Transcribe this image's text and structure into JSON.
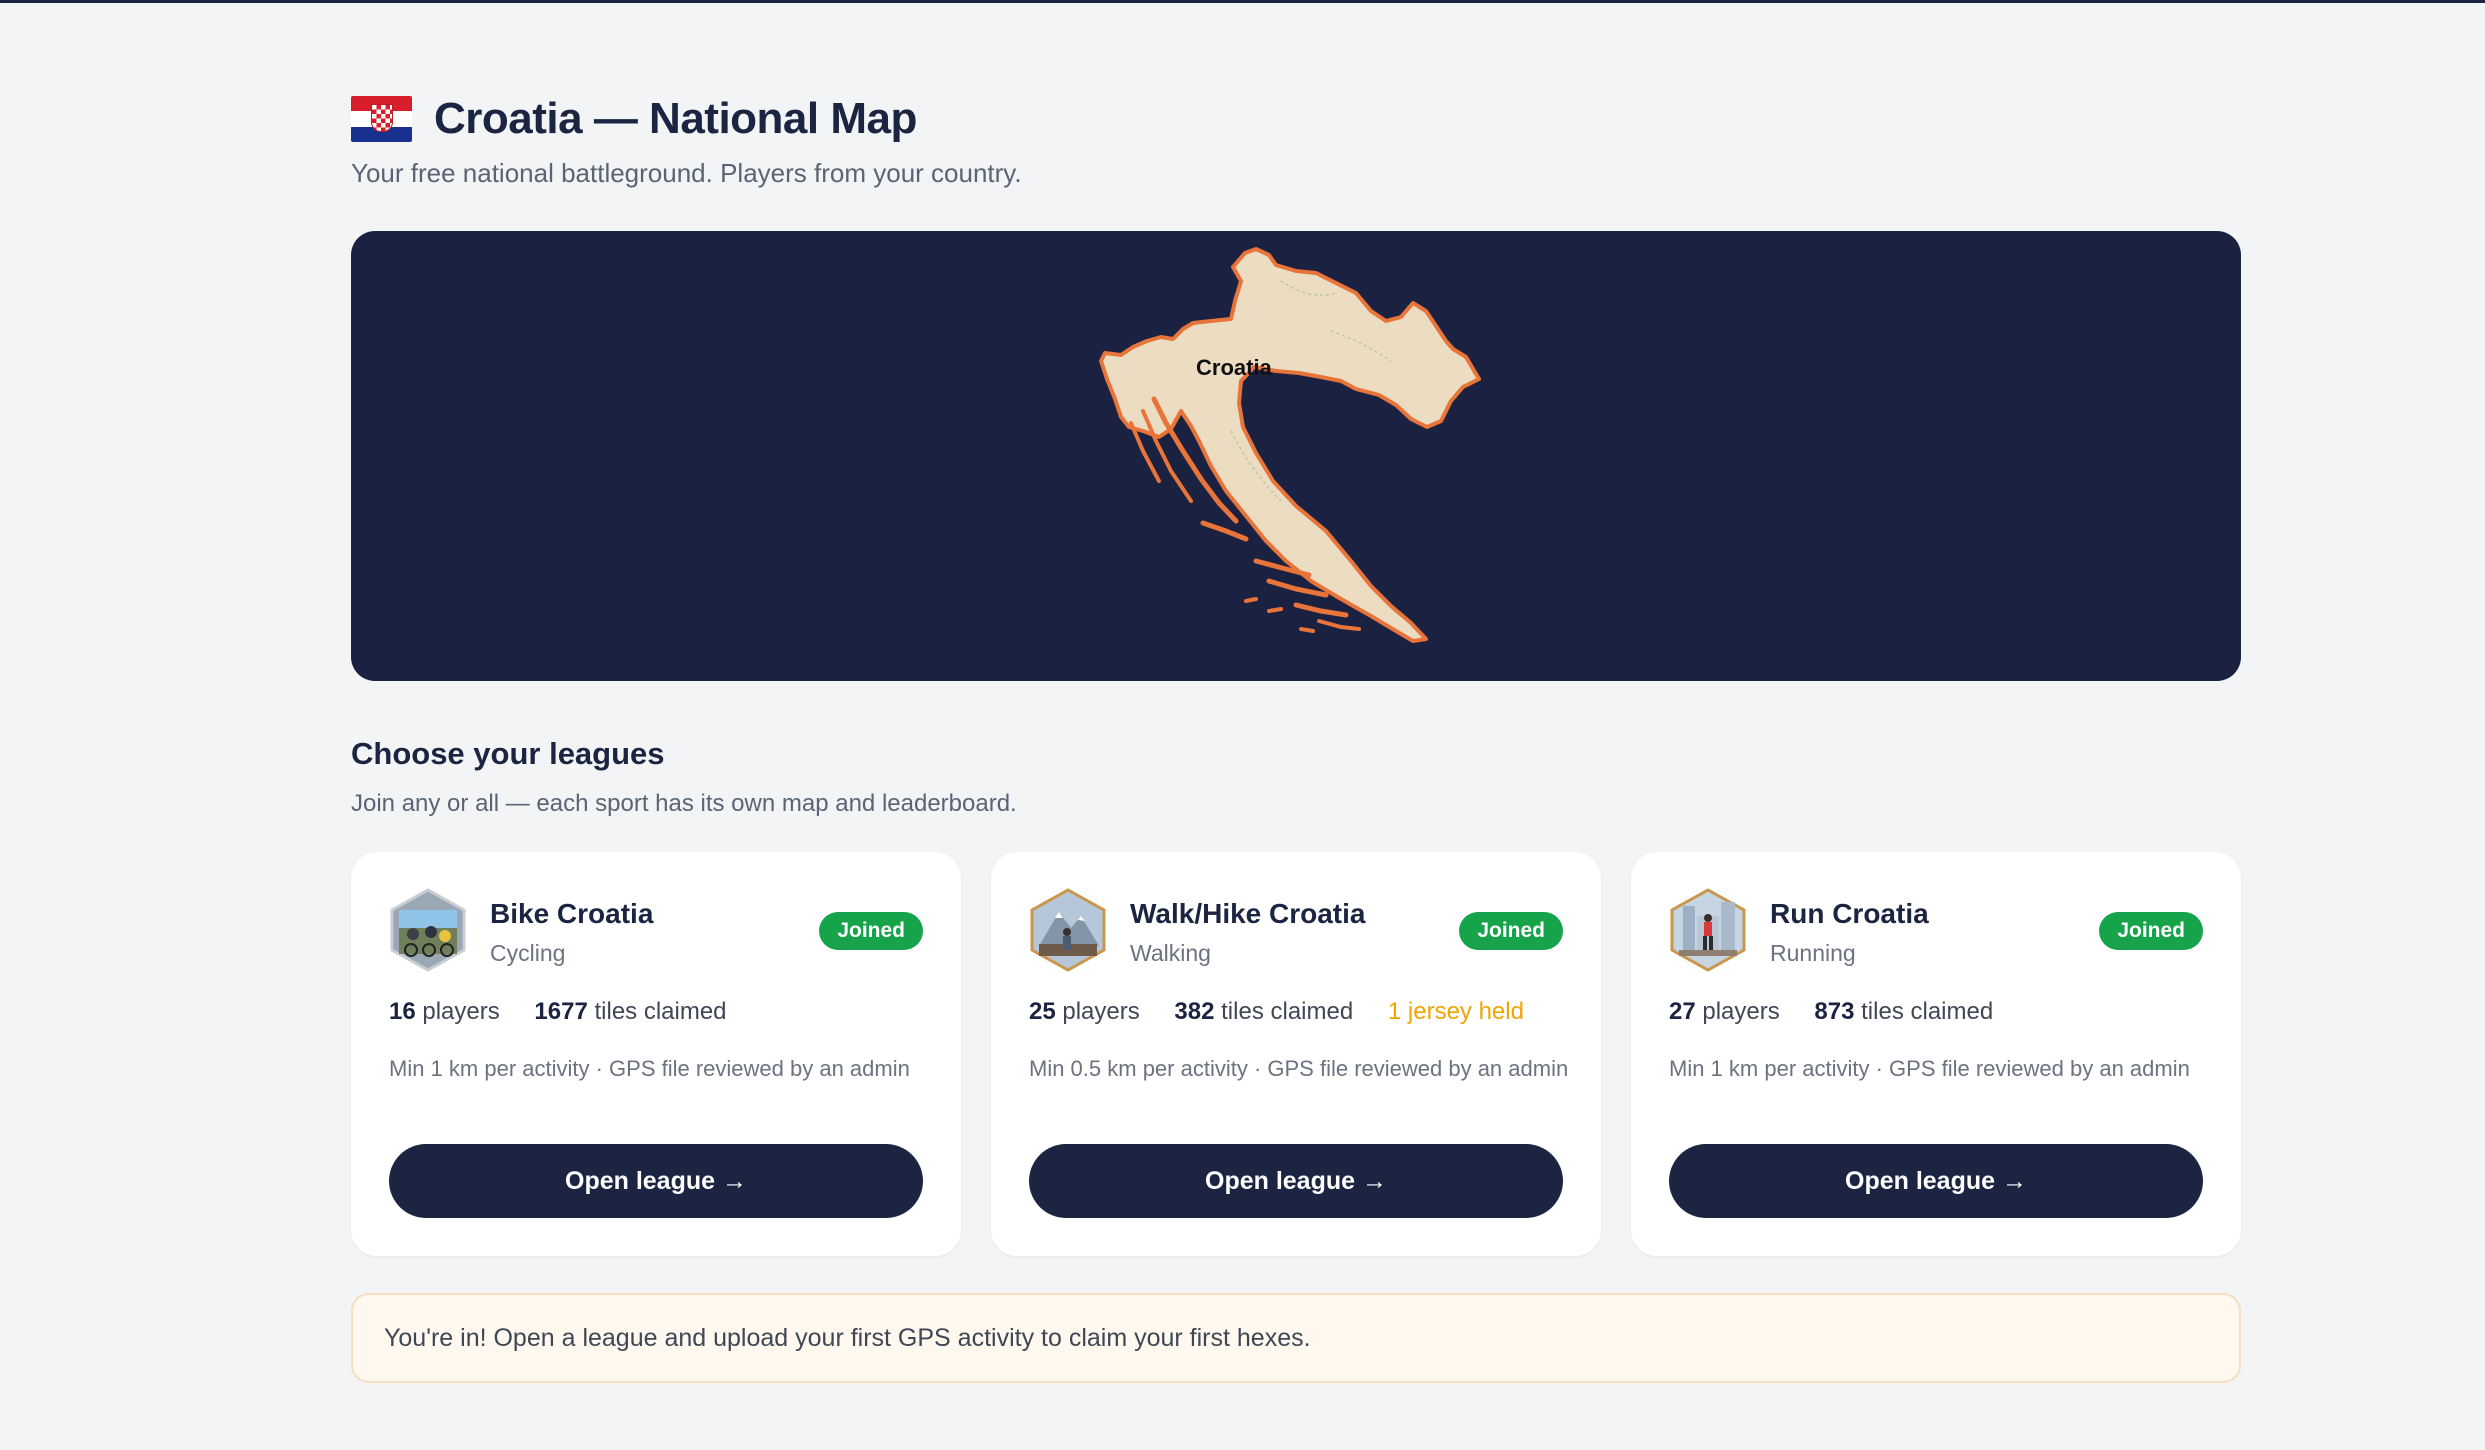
{
  "header": {
    "title": "Croatia — National Map",
    "subtitle": "Your free national battleground. Players from your country."
  },
  "map": {
    "label": "Croatia"
  },
  "leagues_section": {
    "title": "Choose your leagues",
    "subtitle": "Join any or all — each sport has its own map and leaderboard."
  },
  "leagues": [
    {
      "name": "Bike Croatia",
      "sport": "Cycling",
      "status": "Joined",
      "players": "16",
      "players_label": "players",
      "tiles": "1677",
      "tiles_label": "tiles claimed",
      "rules": "Min 1 km per activity · GPS file reviewed by an admin",
      "button": "Open league →",
      "icon": "cyclists-icon"
    },
    {
      "name": "Walk/Hike Croatia",
      "sport": "Walking",
      "status": "Joined",
      "players": "25",
      "players_label": "players",
      "tiles": "382",
      "tiles_label": "tiles claimed",
      "jersey": "1",
      "jersey_label": "jersey held",
      "rules": "Min 0.5 km per activity · GPS file reviewed by an admin",
      "button": "Open league →",
      "icon": "hiker-mountain-icon"
    },
    {
      "name": "Run Croatia",
      "sport": "Running",
      "status": "Joined",
      "players": "27",
      "players_label": "players",
      "tiles": "873",
      "tiles_label": "tiles claimed",
      "rules": "Min 1 km per activity · GPS file reviewed by an admin",
      "button": "Open league →",
      "icon": "runner-city-icon"
    }
  ],
  "notice": {
    "text": "You're in! Open a league and upload your first GPS activity to claim your first hexes."
  },
  "colors": {
    "navy": "#1b2440",
    "map_bg": "#1b2140",
    "joined_green": "#16a34a",
    "jersey_gold": "#f0a500",
    "land": "#ecdcc2",
    "border_orange": "#e8743a"
  }
}
